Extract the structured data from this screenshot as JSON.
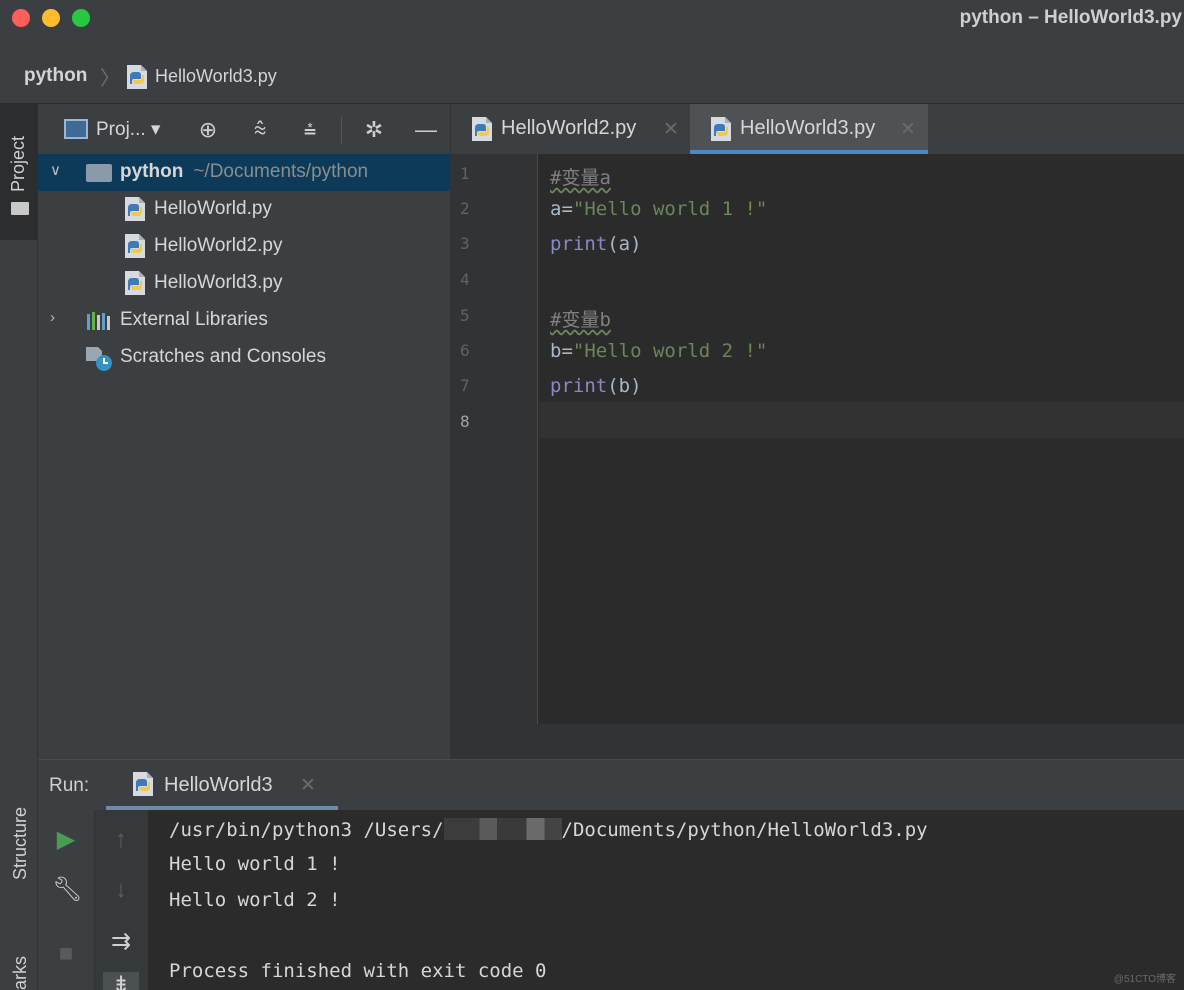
{
  "window": {
    "title": "python – HelloWorld3.py"
  },
  "breadcrumb": {
    "root": "python",
    "file": "HelloWorld3.py"
  },
  "left_strip": {
    "project": "Project",
    "structure": "Structure",
    "bookmarks": "arks"
  },
  "project_panel": {
    "view_label": "Proj...",
    "tree": [
      {
        "label": "python",
        "path": "~/Documents/python",
        "type": "folder",
        "expanded": true,
        "selected": true
      },
      {
        "label": "HelloWorld.py",
        "type": "python-file"
      },
      {
        "label": "HelloWorld2.py",
        "type": "python-file"
      },
      {
        "label": "HelloWorld3.py",
        "type": "python-file"
      },
      {
        "label": "External Libraries",
        "type": "libraries",
        "expanded": false
      },
      {
        "label": "Scratches and Consoles",
        "type": "scratches"
      }
    ]
  },
  "editor": {
    "tabs": [
      {
        "label": "HelloWorld2.py",
        "active": false
      },
      {
        "label": "HelloWorld3.py",
        "active": true
      }
    ],
    "line_numbers": [
      "1",
      "2",
      "3",
      "4",
      "5",
      "6",
      "7",
      "8"
    ],
    "current_line": 8,
    "code": {
      "l1": "#变量a",
      "l2_var": "a=",
      "l2_str": "\"Hello world 1 !\"",
      "l3_fn": "print",
      "l3_args": "(a)",
      "l5": "#变量b",
      "l6_var": "b=",
      "l6_str": "\"Hello world 2 !\"",
      "l7_fn": "print",
      "l7_args": "(b)"
    }
  },
  "run": {
    "label": "Run:",
    "tab": "HelloWorld3",
    "console": {
      "cmd_prefix": "/usr/bin/python3 /Users/",
      "cmd_suffix": "/Documents/python/HelloWorld3.py",
      "out1": "Hello world 1 !",
      "out2": "Hello world 2 !",
      "exit": "Process finished with exit code 0"
    }
  },
  "watermark": "@51CTO博客",
  "colors": {
    "accent": "#4a88c7",
    "run_green": "#499c54",
    "background": "#2b2b2b",
    "panel": "#3c3f41"
  }
}
